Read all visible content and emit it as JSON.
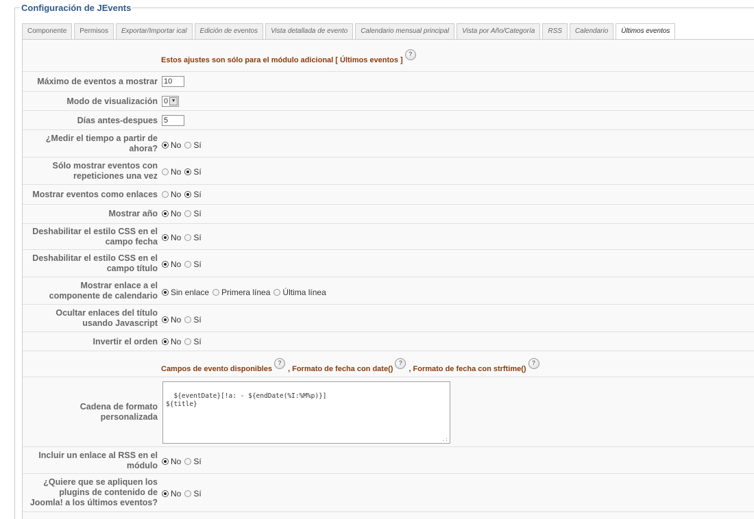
{
  "legend": "Configuración de JEvents",
  "tabs": [
    {
      "label": "Componente"
    },
    {
      "label": "Permisos"
    },
    {
      "label": "Exportar/Importar ical"
    },
    {
      "label": "Edición de eventos"
    },
    {
      "label": "Vista detallada de evento"
    },
    {
      "label": "Calendario mensual principal"
    },
    {
      "label": "Vista por Año/Categoría"
    },
    {
      "label": "RSS"
    },
    {
      "label": "Calendario"
    },
    {
      "label": "Últimos eventos"
    }
  ],
  "module_note": "Estos ajustes son sólo para el módulo adicional [ Últimos eventos ]",
  "help_glyph": "?",
  "fields": {
    "max_events": {
      "label": "Máximo de eventos a mostrar",
      "value": "10"
    },
    "display_mode": {
      "label": "Modo de visualización",
      "value": "0"
    },
    "days": {
      "label": "Días antes-despues",
      "value": "5"
    },
    "measure_now": {
      "label1": "¿Medir el tiempo a partir de",
      "label2": "ahora?",
      "no": "No",
      "yes": "Sí"
    },
    "show_once": {
      "label1": "Sólo mostrar eventos con",
      "label2": "repeticiones una vez",
      "no": "No",
      "yes": "Sí"
    },
    "as_links": {
      "label": "Mostrar eventos como enlaces",
      "no": "No",
      "yes": "Sí"
    },
    "show_year": {
      "label": "Mostrar año",
      "no": "No",
      "yes": "Sí"
    },
    "css_date": {
      "label1": "Deshabilitar el estilo CSS en el",
      "label2": "campo fecha",
      "no": "No",
      "yes": "Sí"
    },
    "css_title": {
      "label1": "Deshabilitar el estilo CSS en el",
      "label2": "campo título",
      "no": "No",
      "yes": "Sí"
    },
    "cal_link": {
      "label1": "Mostrar enlace a el",
      "label2": "componente de calendario",
      "opt1": "Sin enlace",
      "opt2": "Primera línea",
      "opt3": "Última línea"
    },
    "hide_links": {
      "label1": "Ocultar enlaces del título",
      "label2": "usando Javascript",
      "no": "No",
      "yes": "Sí"
    },
    "reverse": {
      "label": "Invertir el orden",
      "no": "No",
      "yes": "Sí"
    },
    "format_heading": {
      "a": "Campos de evento disponibles",
      "b": ", Formato de fecha con date()",
      "c": ", Formato de fecha con strftime()"
    },
    "custom_format": {
      "label1": "Cadena de formato",
      "label2": "personalizada",
      "value": "${eventDate}[!a: - ${endDate(%I:%M%p)}]\n${title}"
    },
    "rss_link": {
      "label1": "Incluir un enlace al RSS en el",
      "label2": "módulo",
      "no": "No",
      "yes": "Sí"
    },
    "plugins": {
      "label1": "¿Quiere que se apliquen los",
      "label2": "plugins de contenido de",
      "label3": "Joomla! a los últimos eventos?",
      "no": "No",
      "yes": "Sí"
    }
  },
  "selections": {
    "measure_now": "No",
    "show_once": "Sí",
    "as_links": "Sí",
    "show_year": "No",
    "css_date": "No",
    "css_title": "No",
    "cal_link": "Sin enlace",
    "hide_links": "No",
    "reverse": "No",
    "rss_link": "No",
    "plugins": "No"
  },
  "colors": {
    "legend": "#2e5b8c",
    "heading": "#8a3b0c",
    "label": "#666666"
  }
}
